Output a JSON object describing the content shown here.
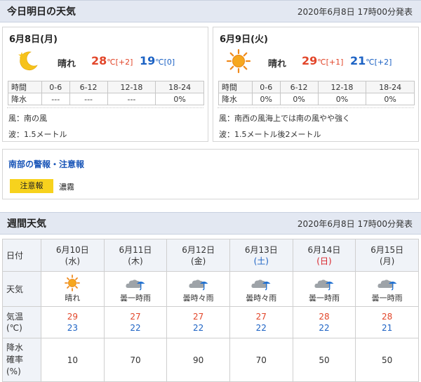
{
  "today": {
    "title": "今日明日の天気",
    "issued": "2020年6月8日 17時00分発表",
    "days": [
      {
        "date": "6月8日(月)",
        "icon": "moon-icon",
        "weather": "晴れ",
        "high": "28",
        "high_unit": "℃",
        "high_diff": "[+2]",
        "low": "19",
        "low_unit": "℃",
        "low_diff": "[0]",
        "period_header": [
          "時間",
          "0-6",
          "6-12",
          "12-18",
          "18-24"
        ],
        "rain_row": [
          "降水",
          "---",
          "---",
          "---",
          "0%"
        ],
        "wind": "風：南の風",
        "wave": "波：1.5メートル"
      },
      {
        "date": "6月9日(火)",
        "icon": "sun-icon",
        "weather": "晴れ",
        "high": "29",
        "high_unit": "℃",
        "high_diff": "[+1]",
        "low": "21",
        "low_unit": "℃",
        "low_diff": "[+2]",
        "period_header": [
          "時間",
          "0-6",
          "6-12",
          "12-18",
          "18-24"
        ],
        "rain_row": [
          "降水",
          "0%",
          "0%",
          "0%",
          "0%"
        ],
        "wind": "風：南西の風海上では南の風やや強く",
        "wave": "波：1.5メートル後2メートル"
      }
    ]
  },
  "warning": {
    "title": "南部の警報・注意報",
    "badge": "注意報",
    "value": "濃霧"
  },
  "weekly": {
    "title": "週間天気",
    "issued": "2020年6月8日 17時00分発表",
    "labels": {
      "date": "日付",
      "weather": "天気",
      "temp_1": "気温",
      "temp_2": "(℃)",
      "pop_1": "降水",
      "pop_2": "確率",
      "pop_3": "(%)"
    },
    "days": [
      {
        "date": "6月10日",
        "dow": "(水)",
        "dow_type": "weekday",
        "icon": "sun-icon",
        "weather": "晴れ",
        "high": "29",
        "low": "23",
        "pop": "10"
      },
      {
        "date": "6月11日",
        "dow": "(木)",
        "dow_type": "weekday",
        "icon": "cloud-umbrella-icon",
        "weather": "曇一時雨",
        "high": "27",
        "low": "22",
        "pop": "70"
      },
      {
        "date": "6月12日",
        "dow": "(金)",
        "dow_type": "weekday",
        "icon": "cloud-umbrella-icon",
        "weather": "曇時々雨",
        "high": "27",
        "low": "22",
        "pop": "90"
      },
      {
        "date": "6月13日",
        "dow": "(土)",
        "dow_type": "sat",
        "icon": "cloud-umbrella-icon",
        "weather": "曇時々雨",
        "high": "27",
        "low": "22",
        "pop": "70"
      },
      {
        "date": "6月14日",
        "dow": "(日)",
        "dow_type": "sun",
        "icon": "cloud-umbrella-icon",
        "weather": "曇一時雨",
        "high": "28",
        "low": "22",
        "pop": "50"
      },
      {
        "date": "6月15日",
        "dow": "(月)",
        "dow_type": "weekday",
        "icon": "cloud-umbrella-icon",
        "weather": "曇一時雨",
        "high": "28",
        "low": "21",
        "pop": "50"
      }
    ]
  },
  "colors": {
    "header_bg": "#e3e8f2",
    "high_temp": "#e2462a",
    "low_temp": "#1c62c4",
    "warning_badge": "#f7d21d",
    "link_blue": "#1a56b8"
  }
}
